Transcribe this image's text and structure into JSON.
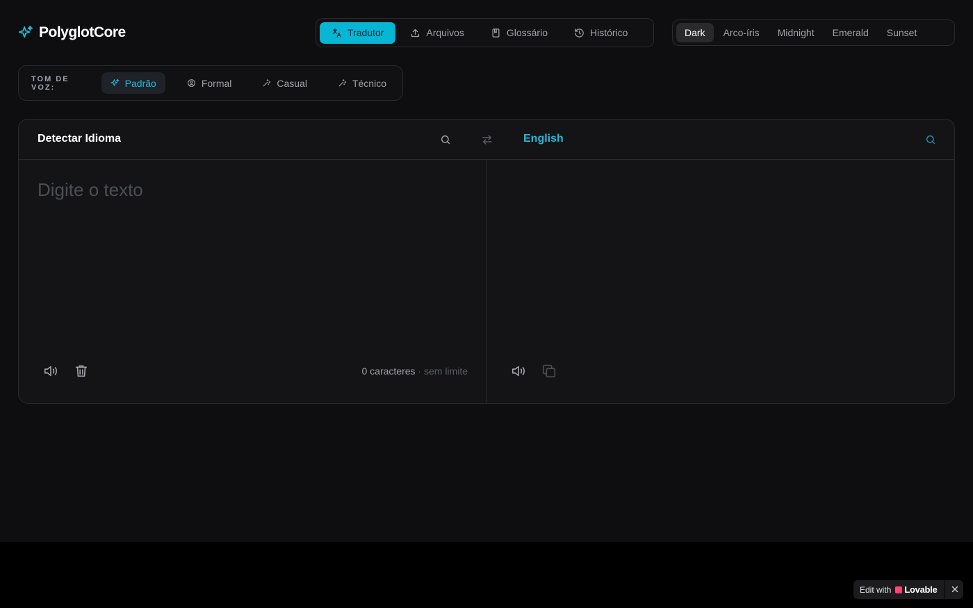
{
  "app": {
    "title": "PolyglotCore"
  },
  "nav": {
    "tabs": [
      {
        "label": "Tradutor",
        "icon": "translate-icon",
        "active": true
      },
      {
        "label": "Arquivos",
        "icon": "upload-icon",
        "active": false
      },
      {
        "label": "Glossário",
        "icon": "book-icon",
        "active": false
      },
      {
        "label": "Histórico",
        "icon": "history-icon",
        "active": false
      }
    ]
  },
  "themes": {
    "items": [
      {
        "label": "Dark",
        "active": true
      },
      {
        "label": "Arco-íris",
        "active": false
      },
      {
        "label": "Midnight",
        "active": false
      },
      {
        "label": "Emerald",
        "active": false
      },
      {
        "label": "Sunset",
        "active": false
      }
    ]
  },
  "tone": {
    "label": "TOM DE VOZ:",
    "options": [
      {
        "label": "Padrão",
        "icon": "sparkles-icon",
        "active": true
      },
      {
        "label": "Formal",
        "icon": "user-circle-icon",
        "active": false
      },
      {
        "label": "Casual",
        "icon": "wand-icon",
        "active": false
      },
      {
        "label": "Técnico",
        "icon": "wand-icon",
        "active": false
      }
    ]
  },
  "translator": {
    "source_language": "Detectar Idioma",
    "target_language": "English",
    "source_placeholder": "Digite o texto",
    "source_value": "",
    "char_count": "0 caracteres",
    "separator": "·",
    "limit": "sem limite"
  },
  "badge": {
    "prefix": "Edit with",
    "brand": "Lovable"
  },
  "colors": {
    "accent": "#06b6d4",
    "accent_text": "#22b8d6",
    "background": "#0e0e10",
    "panel": "#141416",
    "border": "#2a2a2e"
  }
}
